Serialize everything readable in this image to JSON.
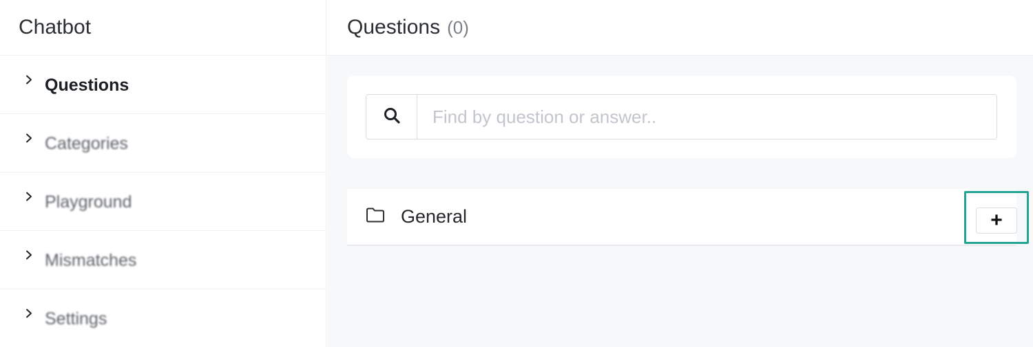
{
  "sidebar": {
    "title": "Chatbot",
    "items": [
      {
        "label": "Questions",
        "active": true
      },
      {
        "label": "Categories",
        "active": false
      },
      {
        "label": "Playground",
        "active": false
      },
      {
        "label": "Mismatches",
        "active": false
      },
      {
        "label": "Settings",
        "active": false
      }
    ]
  },
  "main": {
    "title": "Questions",
    "count": "(0)",
    "search": {
      "placeholder": "Find by question or answer..",
      "value": "",
      "icon": "search-icon"
    },
    "categories": [
      {
        "name": "General",
        "icon": "folder-icon",
        "add_label": "+"
      }
    ]
  },
  "colors": {
    "highlight": "#22a394",
    "background": "#f7f8fa",
    "border": "#d9dde2"
  }
}
